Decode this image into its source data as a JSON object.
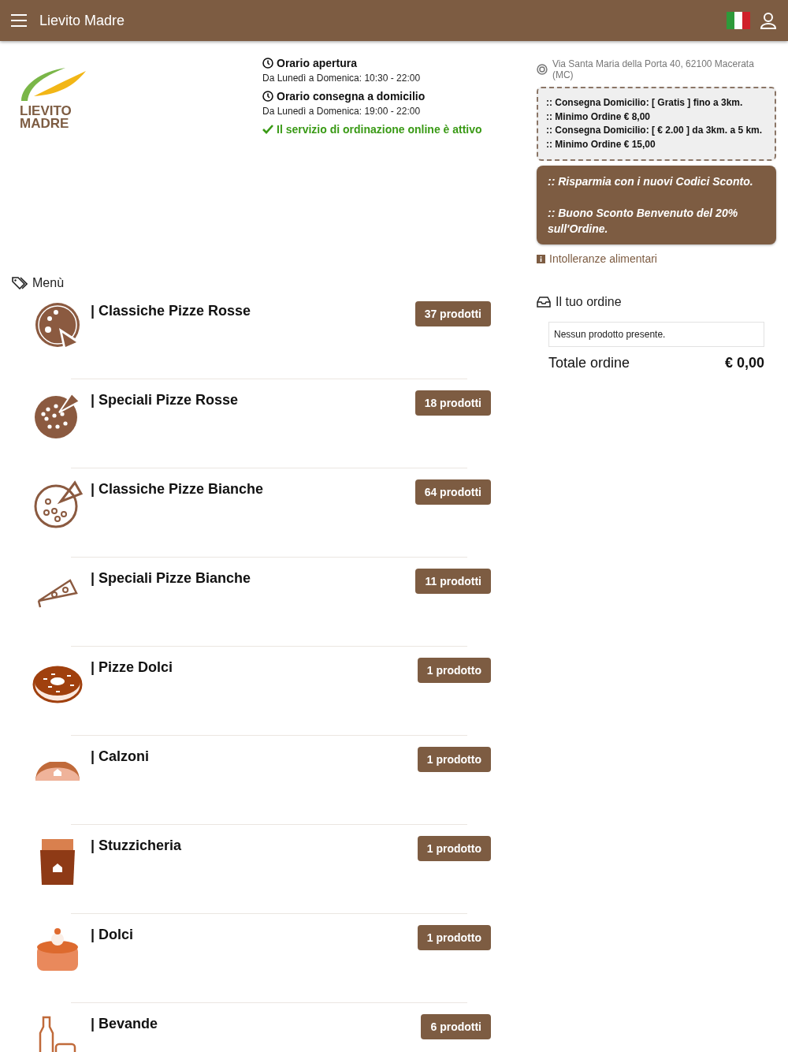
{
  "header": {
    "title": "Lievito Madre"
  },
  "logo": {
    "line1": "LIEVITO",
    "line2": "MADRE"
  },
  "hours": [
    {
      "title": "Orario apertura",
      "text": "Da Lunedì a Domenica: 10:30 - 22:00"
    },
    {
      "title": "Orario consegna a domicilio",
      "text": "Da Lunedì a Domenica: 19:00 - 22:00"
    }
  ],
  "service_status": {
    "text": "Il servizio di ordinazione online è attivo",
    "active": true
  },
  "address": "Via Santa Maria della Porta 40, 62100 Macerata (MC)",
  "delivery_info": [
    ":: Consegna Domicilio: [ Gratis ] fino a 3km.",
    ":: Minimo Ordine € 8,00",
    ":: Consegna Domicilio: [ € 2.00 ] da 3km. a 5 km.",
    ":: Minimo Ordine € 15,00"
  ],
  "promo": [
    ":: Risparmia con i nuovi Codici Sconto.",
    ":: Buono Sconto Benvenuto del 20% sull'Ordine."
  ],
  "allergens_link": "Intolleranze alimentari",
  "menu": {
    "title": "Menù",
    "categories": [
      {
        "name": "| Classiche Pizze Rosse",
        "count": "37 prodotti",
        "kind": "pizza"
      },
      {
        "name": "| Speciali Pizze Rosse",
        "count": "18 prodotti",
        "kind": "pizza-dots"
      },
      {
        "name": "| Classiche Pizze Bianche",
        "count": "64 prodotti",
        "kind": "pizza-outline"
      },
      {
        "name": "| Speciali Pizze Bianche",
        "count": "11 prodotti",
        "kind": "slice"
      },
      {
        "name": "| Pizze Dolci",
        "count": "1 prodotto",
        "kind": "donut"
      },
      {
        "name": "| Calzoni",
        "count": "1 prodotto",
        "kind": "calzone"
      },
      {
        "name": "| Stuzzicheria",
        "count": "1 prodotto",
        "kind": "fries"
      },
      {
        "name": "| Dolci",
        "count": "1 prodotto",
        "kind": "cake"
      },
      {
        "name": "| Bevande",
        "count": "6 prodotti",
        "kind": "bottle"
      }
    ]
  },
  "order": {
    "title": "Il tuo ordine",
    "empty_text": "Nessun prodotto presente.",
    "total_label": "Totale ordine",
    "total_value": "€ 0,00"
  }
}
